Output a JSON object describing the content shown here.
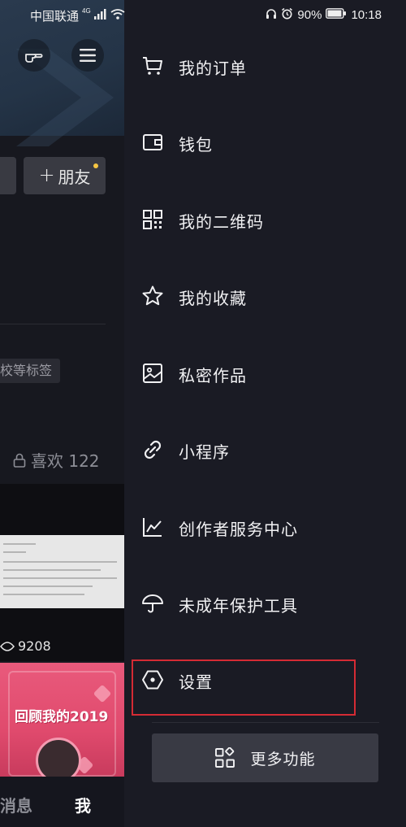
{
  "status_bar": {
    "carrier": "中国联通",
    "network": "4G",
    "battery": "90%",
    "time": "10:18"
  },
  "background_page": {
    "add_friend_label": "朋友",
    "tag_text": "校等标签",
    "likes_label": "喜欢 122",
    "video_views": "9208",
    "video_title": "回顾我的2019",
    "tab_messages": "消息",
    "tab_me": "我"
  },
  "drawer": {
    "items": [
      {
        "label": "我的订单",
        "icon": "cart-icon"
      },
      {
        "label": "钱包",
        "icon": "wallet-icon"
      },
      {
        "label": "我的二维码",
        "icon": "qr-code-icon"
      },
      {
        "label": "我的收藏",
        "icon": "star-icon"
      },
      {
        "label": "私密作品",
        "icon": "image-icon"
      },
      {
        "label": "小程序",
        "icon": "link-icon"
      },
      {
        "label": "创作者服务中心",
        "icon": "chart-icon"
      },
      {
        "label": "未成年保护工具",
        "icon": "umbrella-icon"
      },
      {
        "label": "设置",
        "icon": "settings-hexagon-icon"
      }
    ],
    "more_label": "更多功能",
    "highlighted_item": "设置"
  },
  "colors": {
    "drawer_bg": "#1a1b24",
    "highlight": "#d52b34",
    "accent_dot": "#f5c542"
  }
}
